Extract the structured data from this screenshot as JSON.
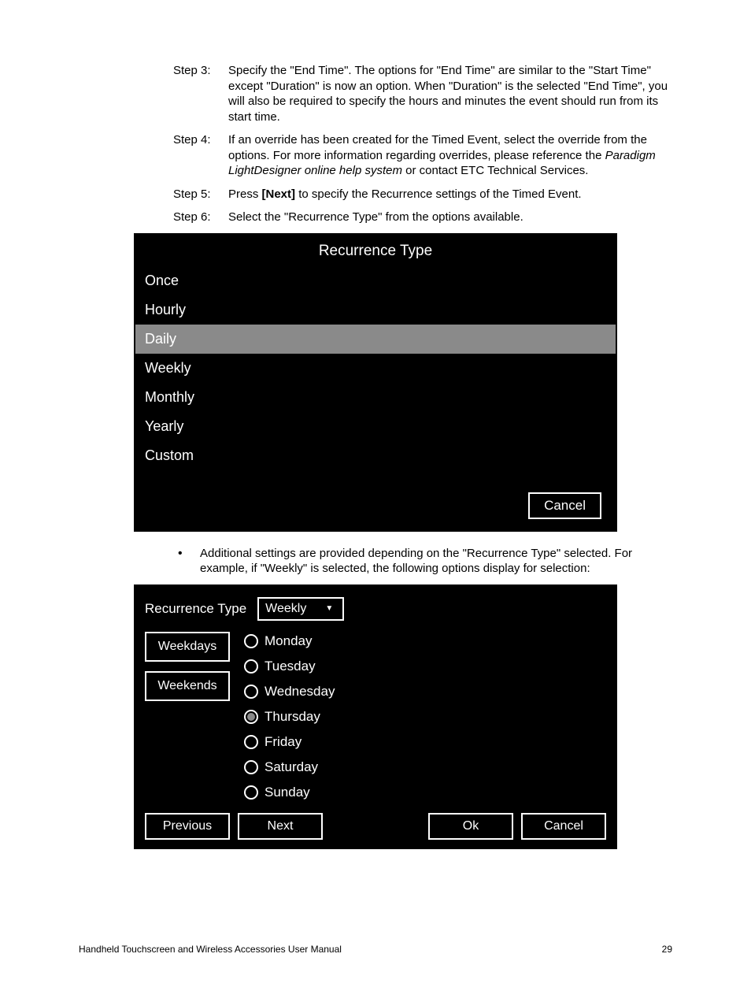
{
  "steps": [
    {
      "label": "Step 3:",
      "html": "Specify the \"End Time\". The options for \"End Time\" are similar to the \"Start Time\" except \"Duration\" is now an option. When \"Duration\" is the selected \"End Time\", you will also be required to specify the hours and minutes the event should run from its start time."
    },
    {
      "label": "Step 4:",
      "html": "If an override has been created for the Timed Event, select the override from the options. For more information regarding overrides, please reference the <em>Paradigm LightDesigner online help system</em> or contact ETC Technical Services."
    },
    {
      "label": "Step 5:",
      "html": "Press <b>[Next]</b> to specify the Recurrence settings of the Timed Event."
    },
    {
      "label": "Step 6:",
      "html": "Select the \"Recurrence Type\" from the options available."
    }
  ],
  "shot1": {
    "title": "Recurrence Type",
    "items": [
      {
        "label": "Once",
        "selected": false
      },
      {
        "label": "Hourly",
        "selected": false
      },
      {
        "label": "Daily",
        "selected": true
      },
      {
        "label": "Weekly",
        "selected": false
      },
      {
        "label": "Monthly",
        "selected": false
      },
      {
        "label": "Yearly",
        "selected": false
      },
      {
        "label": "Custom",
        "selected": false
      }
    ],
    "cancel": "Cancel"
  },
  "bullet": "Additional settings are provided depending on the \"Recurrence Type\" selected. For example, if \"Weekly\" is selected, the following options display for selection:",
  "shot2": {
    "field_label": "Recurrence Type",
    "dropdown_value": "Weekly",
    "side_buttons": [
      "Weekdays",
      "Weekends"
    ],
    "days": [
      {
        "label": "Monday",
        "selected": false
      },
      {
        "label": "Tuesday",
        "selected": false
      },
      {
        "label": "Wednesday",
        "selected": false
      },
      {
        "label": "Thursday",
        "selected": true
      },
      {
        "label": "Friday",
        "selected": false
      },
      {
        "label": "Saturday",
        "selected": false
      },
      {
        "label": "Sunday",
        "selected": false
      }
    ],
    "nav": {
      "previous": "Previous",
      "next": "Next",
      "ok": "Ok",
      "cancel": "Cancel"
    }
  },
  "footer": {
    "left": "Handheld Touchscreen and Wireless Accessories User Manual",
    "right": "29"
  }
}
